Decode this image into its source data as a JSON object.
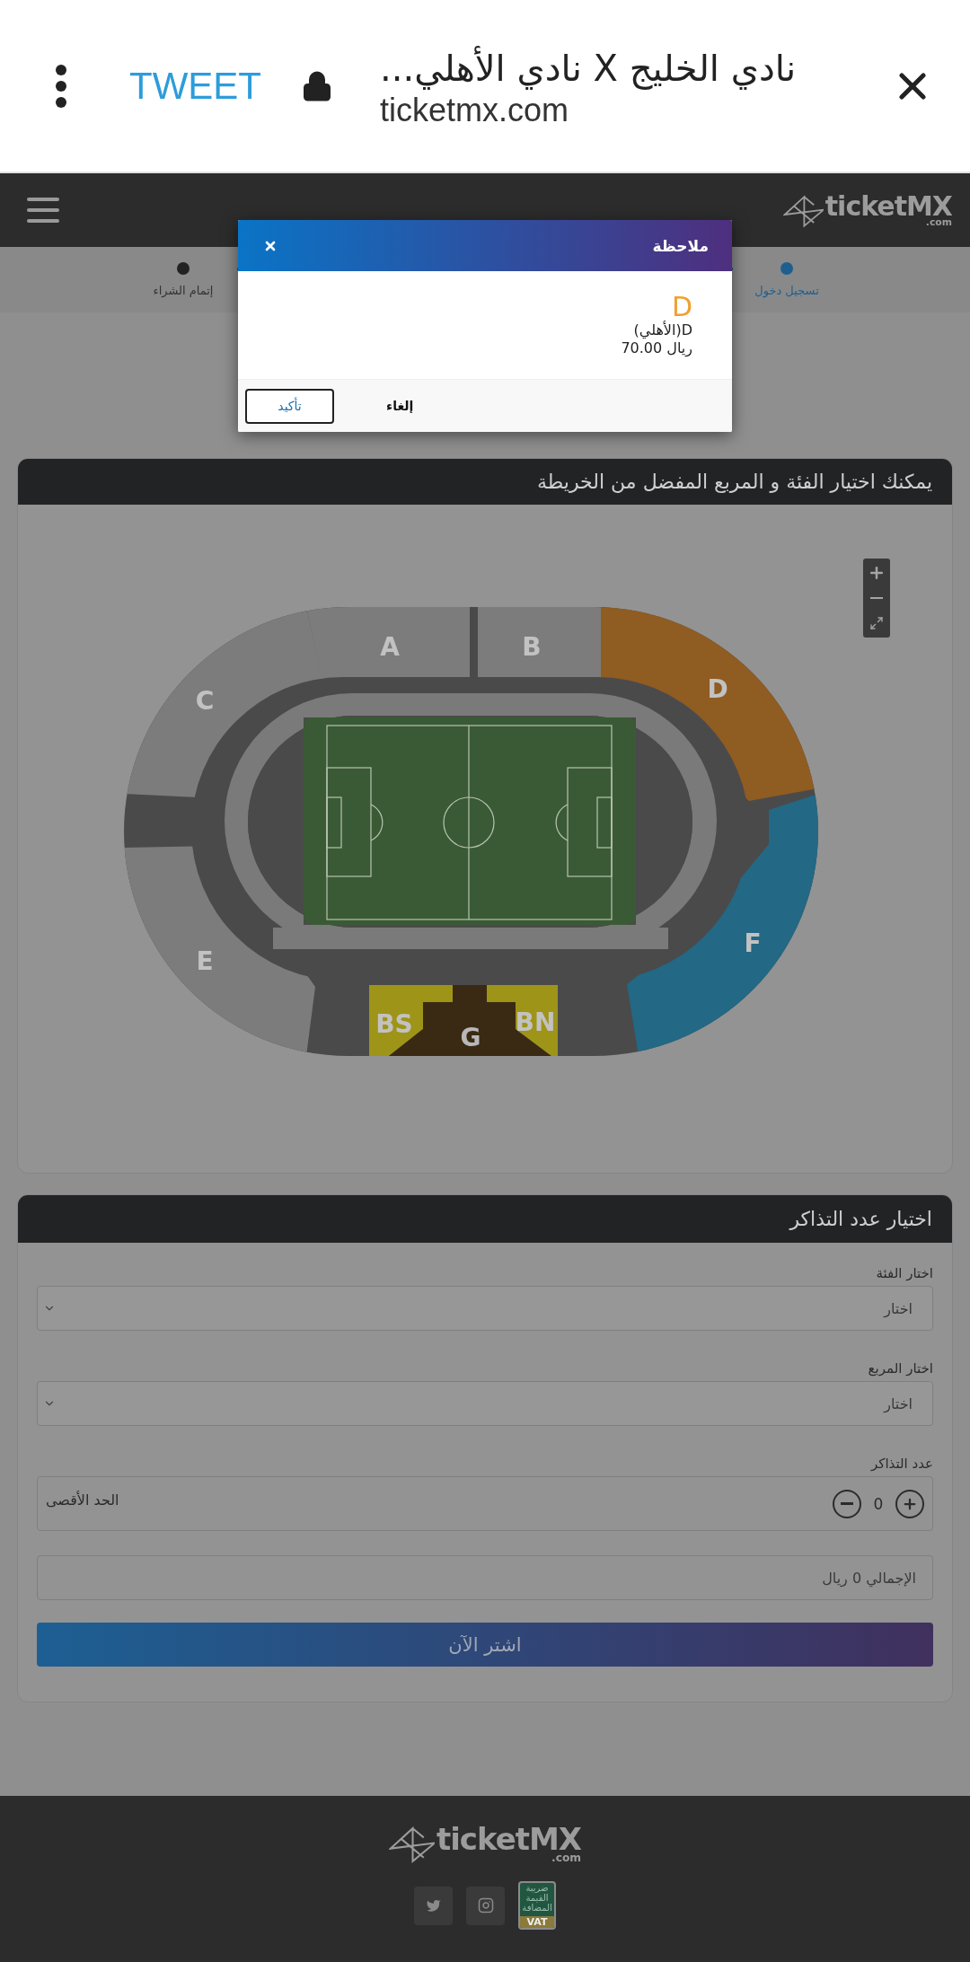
{
  "browser": {
    "title": "نادي الخليج X نادي الأهلي...",
    "url": "ticketmx.com",
    "action": "TWEET"
  },
  "header": {
    "logo": "ticketMX",
    "logo_suffix": ".com"
  },
  "steps": [
    {
      "label": "تسجيل دخول",
      "active": true
    },
    {
      "label": "إتمام الشراء",
      "active": false
    }
  ],
  "modal": {
    "title": "ملاحظة",
    "section": "D",
    "detail": "D(الأهلي)",
    "price": "ريال 70.00",
    "buttons": [
      {
        "label": "إلغاء",
        "kind": "plain"
      },
      {
        "label": "تأكيد",
        "kind": "outlined"
      }
    ]
  },
  "map": {
    "title": "يمكنك اختيار الفئة و المربع المفضل من الخريطة",
    "sections": [
      {
        "label": "C",
        "color": "#7c7c7c"
      },
      {
        "label": "A",
        "color": "#7c7c7c"
      },
      {
        "label": "B",
        "color": "#7c7c7c"
      },
      {
        "label": "D",
        "color": "#8f5c22"
      },
      {
        "label": "F",
        "color": "#236884"
      },
      {
        "label": "E",
        "color": "#7c7c7c"
      },
      {
        "label": "BS",
        "color": "#9e9418"
      },
      {
        "label": "G",
        "color": "#3a2a14"
      },
      {
        "label": "BN",
        "color": "#9e9418"
      }
    ]
  },
  "tickets": {
    "title": "اختيار عدد التذاكر",
    "fields": [
      {
        "label": "اختار الفئة",
        "value": "اختار"
      },
      {
        "label": "اختار المربع",
        "value": "اختار"
      }
    ],
    "counter": {
      "label": "عدد التذاكر",
      "count": "0",
      "note": "الحد الأقصى"
    },
    "total": "الإجمالي 0 ريال",
    "submit": "اشتر الآن"
  },
  "footer": {
    "logo": "ticketMX",
    "logo_suffix": ".com",
    "vat": {
      "lines": [
        "ضريبة",
        "القيمة",
        "المضافة"
      ],
      "code": "VAT"
    }
  }
}
